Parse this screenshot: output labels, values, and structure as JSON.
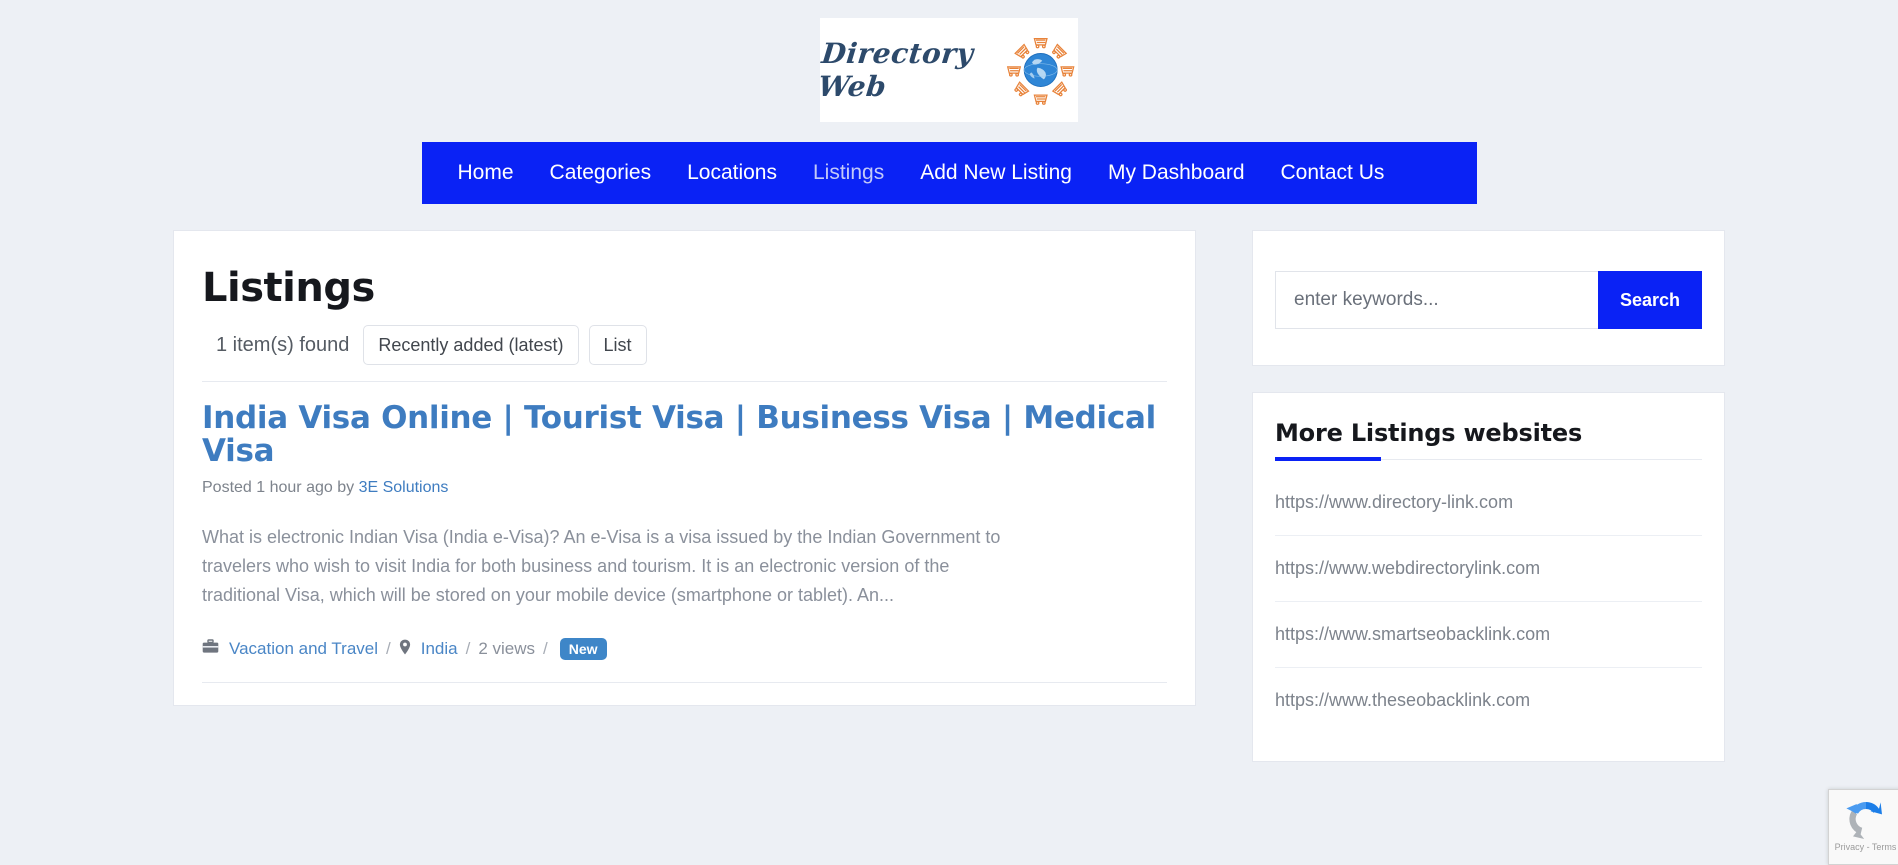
{
  "site": {
    "logo_text": "Directory Web",
    "logo_icon": "globe-with-shopping-carts-icon"
  },
  "nav": {
    "items": [
      {
        "label": "Home",
        "active": false
      },
      {
        "label": "Categories",
        "active": false
      },
      {
        "label": "Locations",
        "active": false
      },
      {
        "label": "Listings",
        "active": true
      },
      {
        "label": "Add New Listing",
        "active": false
      },
      {
        "label": "My Dashboard",
        "active": false
      },
      {
        "label": "Contact Us",
        "active": false
      }
    ]
  },
  "main": {
    "title": "Listings",
    "items_found": "1 item(s) found",
    "sort_value": "Recently added (latest)",
    "view_value": "List",
    "listing": {
      "title": "India Visa Online | Tourist Visa | Business Visa | Medical Visa",
      "posted_prefix": "Posted 1 hour ago by",
      "author": "3E Solutions",
      "description": "What is electronic Indian Visa (India e-Visa)? An e-Visa is a visa issued by the Indian Government to travelers who wish to visit India for both business and tourism. It is an electronic version of the traditional Visa, which will be stored on your mobile device (smartphone or tablet). An...",
      "category": "Vacation and Travel",
      "location": "India",
      "views": "2 views",
      "badge": "New",
      "separator": "/"
    }
  },
  "sidebar": {
    "search": {
      "placeholder": "enter keywords...",
      "button_label": "Search"
    },
    "links_widget": {
      "title": "More Listings websites",
      "links": [
        "https://www.directory-link.com",
        "https://www.webdirectorylink.com",
        "https://www.smartseobacklink.com",
        "https://www.theseobacklink.com"
      ]
    }
  },
  "recaptcha": {
    "text": "Privacy - Terms"
  },
  "colors": {
    "nav_blue": "#0a22f5",
    "link_blue": "#3e7cc0",
    "badge_blue": "#3e86c8",
    "page_bg": "#edf0f5"
  }
}
